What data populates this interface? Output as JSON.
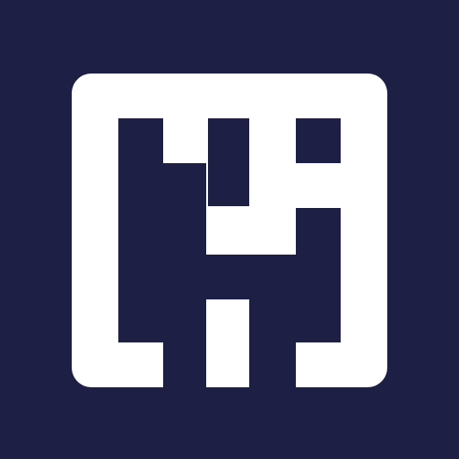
{
  "colors": {
    "background": "#1e1f45",
    "logo": "#ffffff"
  },
  "icon": "c49-maze-logo-icon"
}
